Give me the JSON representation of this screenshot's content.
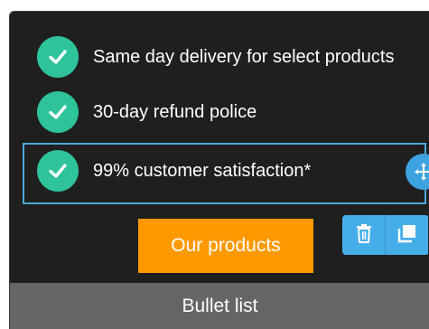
{
  "bullets": [
    {
      "text": "Same day delivery for select products",
      "icon": "checkmark-icon"
    },
    {
      "text": "30-day refund police",
      "icon": "checkmark-icon"
    },
    {
      "text": "99% customer satisfaction*",
      "icon": "checkmark-icon"
    }
  ],
  "cta": {
    "label": "Our products"
  },
  "toolbar": {
    "delete_icon": "trash-icon",
    "duplicate_icon": "duplicate-icon"
  },
  "caption": "Bullet list",
  "colors": {
    "background": "#1f1f20",
    "check": "#2ec39b",
    "cta": "#ff9900",
    "selection": "#4aa9d6",
    "toolbar": "#45aee8",
    "caption_bar": "#656565"
  }
}
